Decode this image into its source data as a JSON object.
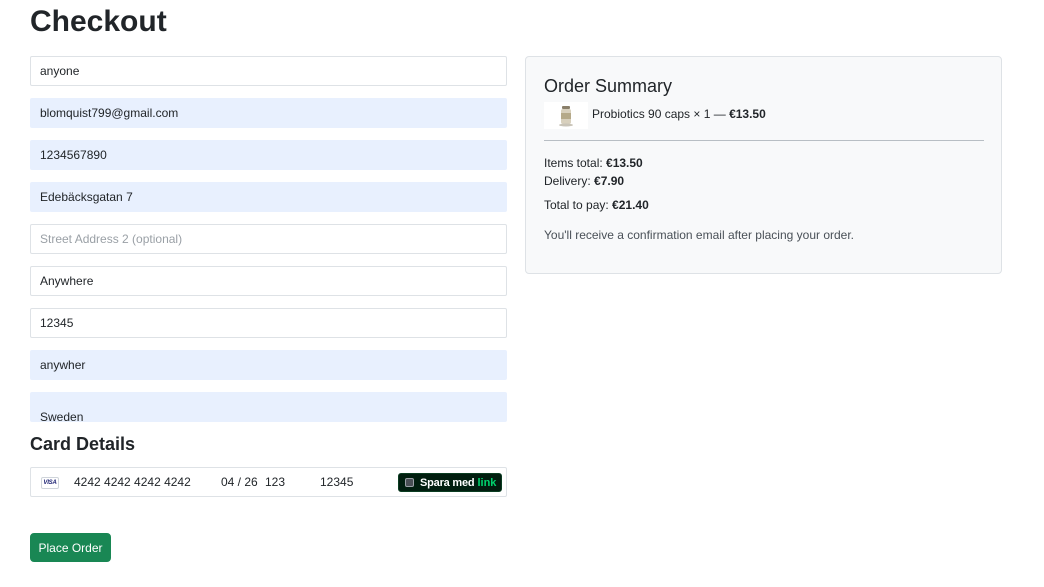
{
  "page": {
    "title": "Checkout"
  },
  "form": {
    "fields": [
      {
        "name": "full-name-field",
        "value": "anyone",
        "autofilled": false,
        "placeholder": ""
      },
      {
        "name": "email-field",
        "value": "blomquist799@gmail.com",
        "autofilled": true,
        "placeholder": ""
      },
      {
        "name": "phone-field",
        "value": "1234567890",
        "autofilled": true,
        "placeholder": ""
      },
      {
        "name": "street-address-field",
        "value": "Edebäcksgatan 7",
        "autofilled": true,
        "placeholder": ""
      },
      {
        "name": "street-address-2-field",
        "value": "",
        "autofilled": false,
        "placeholder": "Street Address 2 (optional)"
      },
      {
        "name": "city-field",
        "value": "Anywhere",
        "autofilled": false,
        "placeholder": ""
      },
      {
        "name": "postal-code-field",
        "value": "12345",
        "autofilled": false,
        "placeholder": ""
      },
      {
        "name": "region-field",
        "value": "anywher",
        "autofilled": true,
        "placeholder": ""
      },
      {
        "name": "country-field",
        "value": "Sweden",
        "autofilled": true,
        "placeholder": ""
      }
    ]
  },
  "card": {
    "section_title": "Card Details",
    "brand_icon": "visa-icon",
    "brand_text": "VISA",
    "number": "4242 4242 4242 4242",
    "expiry": "04 / 26",
    "cvc": "123",
    "postal": "12345",
    "link_save_label": "Spara med",
    "link_brand": "link",
    "link_brand_color": "#00d66f"
  },
  "actions": {
    "place_order_label": "Place Order",
    "accent_color": "#198754"
  },
  "summary": {
    "title": "Order Summary",
    "product": {
      "name": "Probiotics 90 caps × 1 — ",
      "price": "€13.50",
      "thumb_icon": "product-bottle-icon"
    },
    "items_total_label": "Items total: ",
    "items_total_value": "€13.50",
    "delivery_label": "Delivery: ",
    "delivery_value": "€7.90",
    "total_label": "Total to pay: ",
    "total_value": "€21.40",
    "note": "You'll receive a confirmation email after placing your order."
  }
}
